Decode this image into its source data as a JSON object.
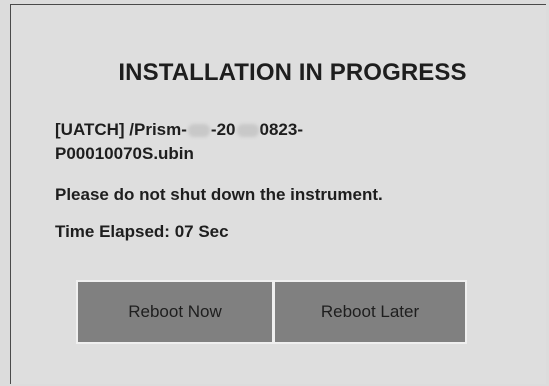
{
  "dialog": {
    "title": "INSTALLATION IN PROGRESS",
    "file_prefix": "[UATCH] /Prism-",
    "file_mid": "-20",
    "file_suffix": "0823-",
    "file_line2": "P00010070S.ubin",
    "warning": "Please do not shut down the instrument.",
    "elapsed_label": "Time Elapsed:",
    "elapsed_value": "07 Sec"
  },
  "buttons": {
    "reboot_now": "Reboot Now",
    "reboot_later": "Reboot Later"
  }
}
